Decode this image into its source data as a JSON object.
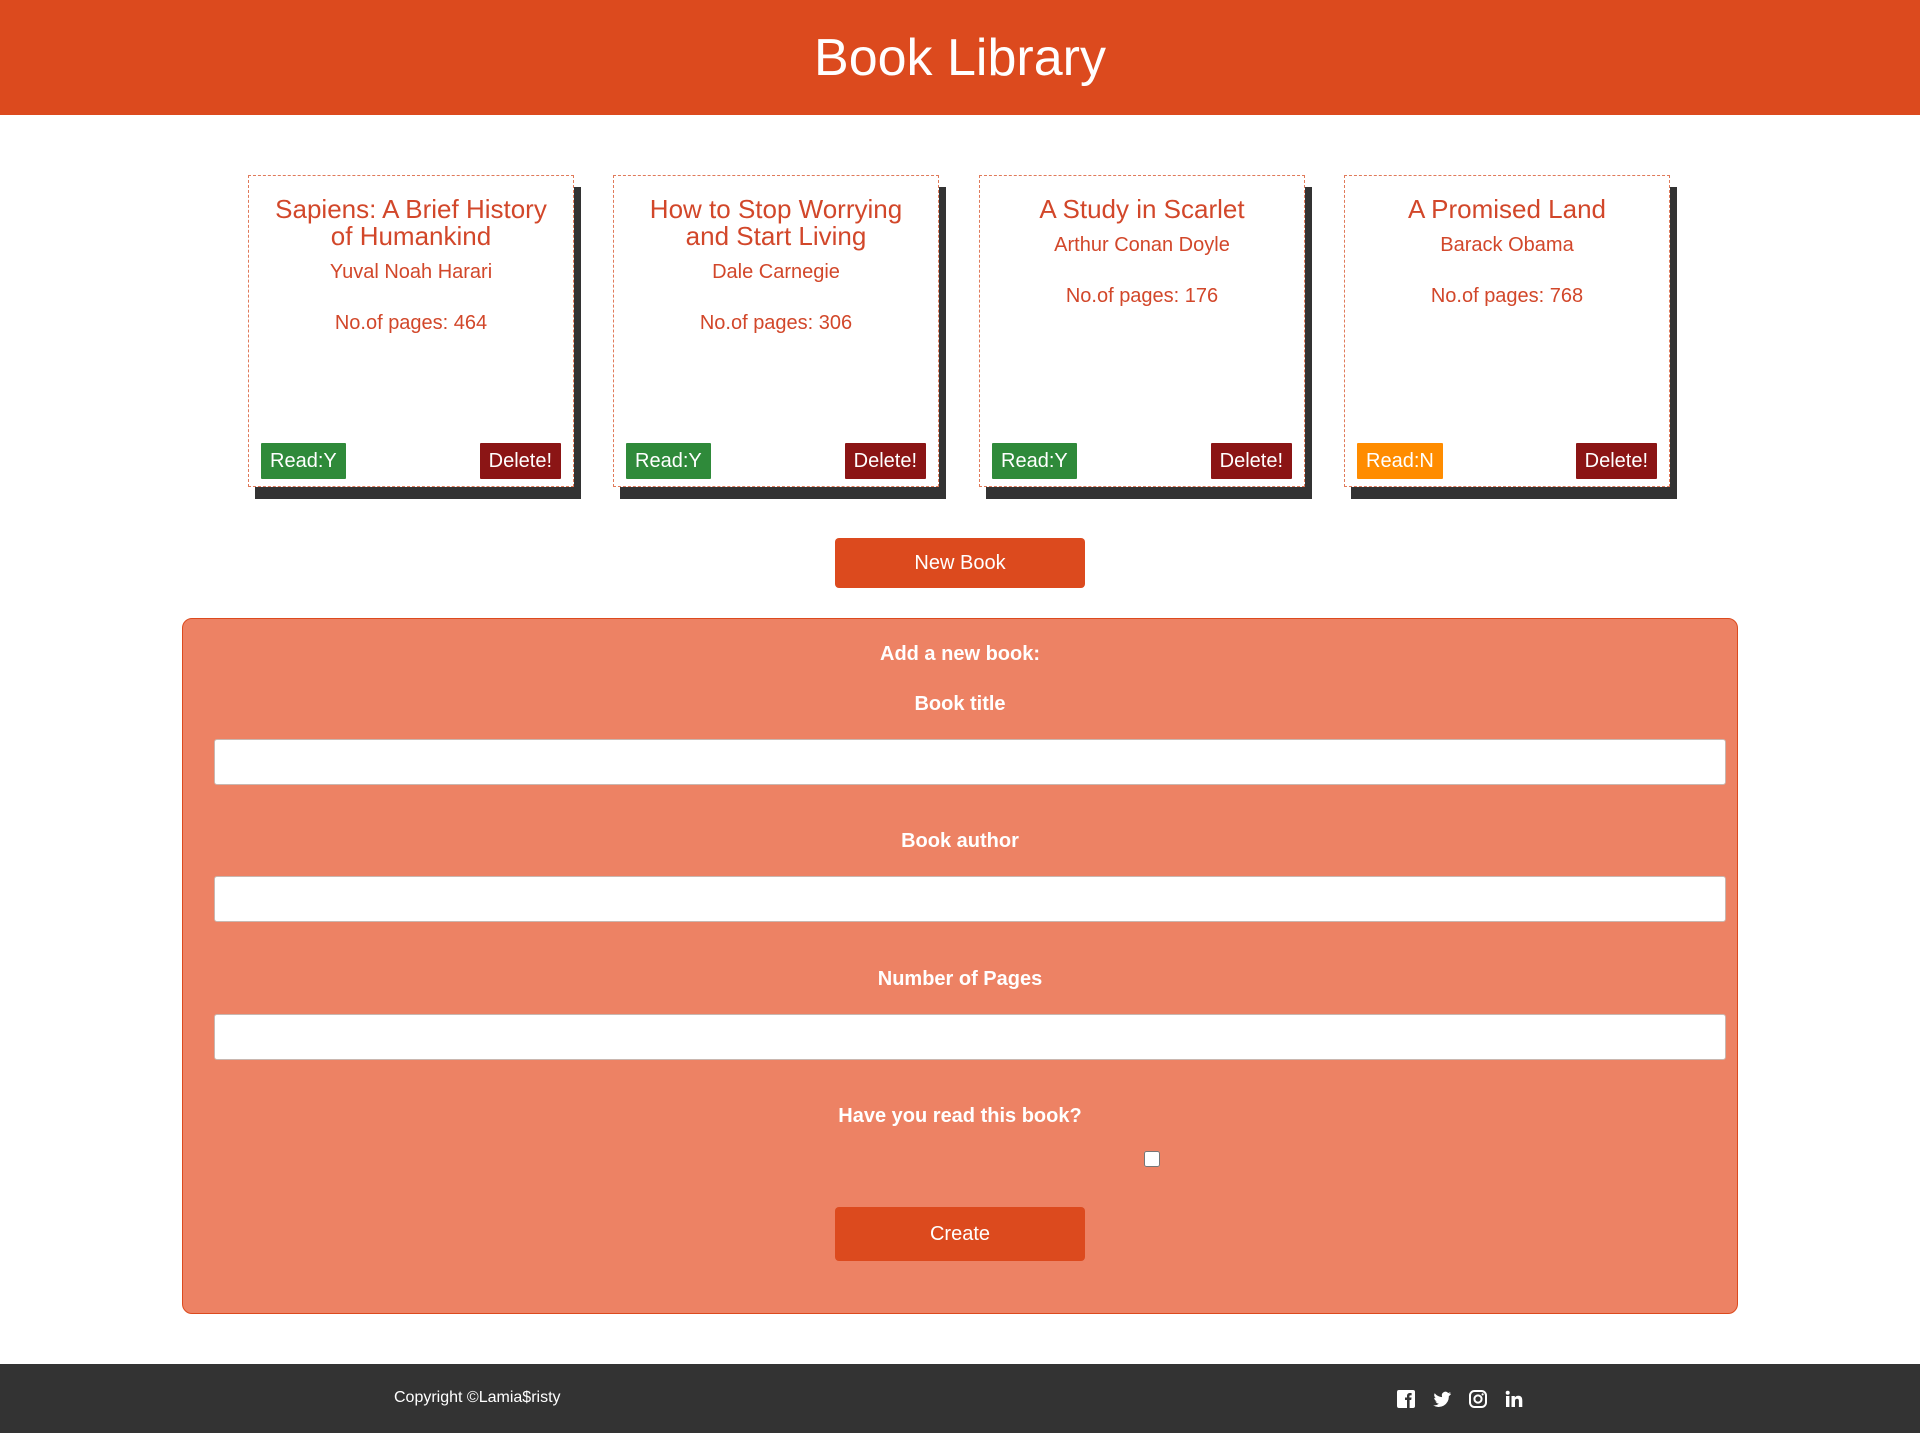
{
  "header": {
    "title": "Book Library"
  },
  "books": [
    {
      "title": "Sapiens: A Brief History of Humankind",
      "author": "Yuval Noah Harari",
      "pages": "No.of pages: 464",
      "read_label": "Read:Y",
      "read": true,
      "delete_label": "Delete!"
    },
    {
      "title": "How to Stop Worrying and Start Living",
      "author": "Dale Carnegie",
      "pages": "No.of pages: 306",
      "read_label": "Read:Y",
      "read": true,
      "delete_label": "Delete!"
    },
    {
      "title": "A Study in Scarlet",
      "author": "Arthur Conan Doyle",
      "pages": "No.of pages: 176",
      "read_label": "Read:Y",
      "read": true,
      "delete_label": "Delete!"
    },
    {
      "title": "A Promised Land",
      "author": "Barack Obama",
      "pages": "No.of pages: 768",
      "read_label": "Read:N",
      "read": false,
      "delete_label": "Delete!"
    }
  ],
  "new_book_label": "New Book",
  "form": {
    "heading": "Add a new book:",
    "title_label": "Book title",
    "title_value": "",
    "author_label": "Book author",
    "author_value": "",
    "pages_label": "Number of Pages",
    "pages_value": "",
    "read_label": "Have you read this book?",
    "read_checked": false,
    "create_label": "Create"
  },
  "footer": {
    "copyright": "Copyright ©Lamia$risty",
    "social_icons": [
      "facebook-icon",
      "twitter-icon",
      "instagram-icon",
      "linkedin-icon"
    ]
  },
  "colors": {
    "brand": "#dc4a1e",
    "form_bg": "#ed8264",
    "read_yes": "#2f8a3a",
    "read_no": "#ff8c00",
    "delete": "#8b1515",
    "footer_bg": "#333333"
  }
}
